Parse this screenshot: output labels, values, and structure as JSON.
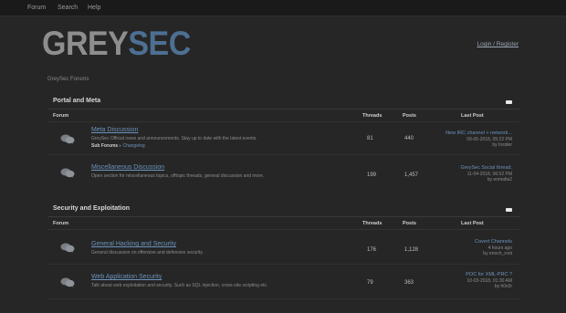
{
  "nav": {
    "forum": "Forum",
    "search": "Search",
    "help": "Help"
  },
  "logo": {
    "grey": "GREY",
    "sec": "SEC"
  },
  "login": "Login / Register",
  "breadcrumb": "GreySec Forums",
  "columns": {
    "forum": "Forum",
    "threads": "Threads",
    "posts": "Posts",
    "last_post": "Last Post"
  },
  "categories": [
    {
      "title": "Portal and Meta",
      "forums": [
        {
          "name": "Meta Discussion",
          "desc": "GreySec Official news and announcements. Stay up to date with the latest events.",
          "sub_label": "Sub Forums",
          "sub_item": "Changelog",
          "threads": "81",
          "posts": "440",
          "last_title": "New IRC channel + network...",
          "last_date": "09-05-2018, 05:22 PM",
          "last_by": "by Insider"
        },
        {
          "name": "Miscellaneous Discussion",
          "desc": "Open section for miscellaneous topics, offtopic threads, general discussion and more.",
          "threads": "199",
          "posts": "1,457",
          "last_title": "GreySec Social thread.",
          "last_date": "11-04-2018, 06:52 PM",
          "last_by": "by enmafia2"
        }
      ]
    },
    {
      "title": "Security and Exploitation",
      "forums": [
        {
          "name": "General Hacking and Security",
          "desc": "General discussion on offensive and defensive security.",
          "threads": "176",
          "posts": "1,128",
          "last_title": "Covert Channels",
          "last_date": "4 hours ago",
          "last_by": "by enoch_root"
        },
        {
          "name": "Web Application Security",
          "desc": "Talk about web exploitation and security. Such as SQL injection, cross-site scripting etc.",
          "threads": "79",
          "posts": "363",
          "last_title": "POC for XML-PRC ?",
          "last_date": "10-03-2018, 01:30 AM",
          "last_by": "by h0x0r"
        }
      ]
    }
  ],
  "colors": {
    "bg": "#262626",
    "link": "#6c93bc",
    "logo_grey": "#8e8e8e",
    "logo_sec": "#4d6f92"
  }
}
